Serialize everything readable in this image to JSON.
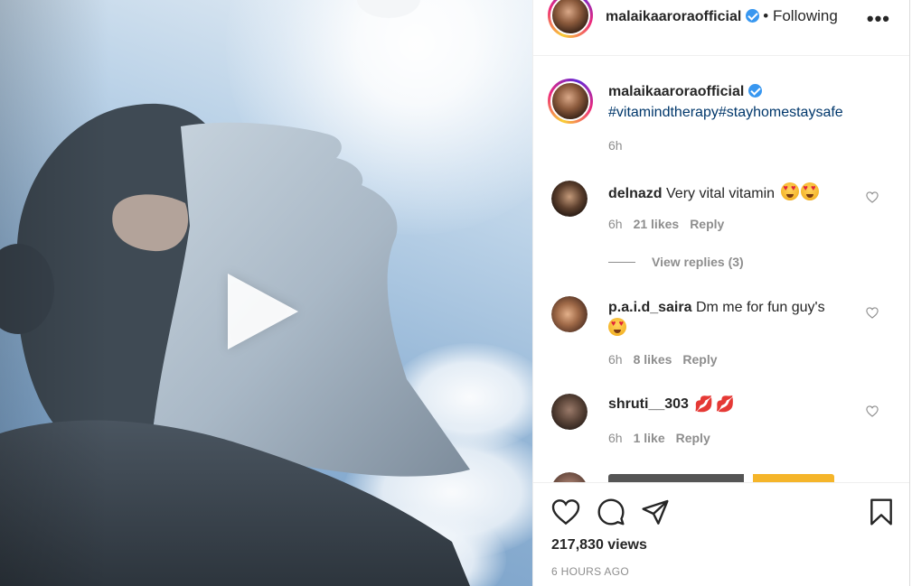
{
  "post": {
    "author": "malaikaaroraofficial",
    "following_label": "• Following",
    "more_label": "•••",
    "caption_hashtags": "#vitamindtherapy#stayhomestaysafe",
    "caption_time": "6h",
    "views": "217,830 views",
    "posted": "6 HOURS AGO"
  },
  "comments": [
    {
      "user": "delnazd",
      "text": "Very vital vitamin",
      "emoji": [
        "heart-eyes",
        "heart-eyes"
      ],
      "time": "6h",
      "likes": "21 likes",
      "reply": "Reply",
      "view_replies": "View replies (3)"
    },
    {
      "user": "p.a.i.d_saira",
      "text": "Dm me for fun guy's",
      "emoji": [
        "heart-eyes"
      ],
      "time": "6h",
      "likes": "8 likes",
      "reply": "Reply"
    },
    {
      "user": "shruti__303",
      "text": "",
      "emoji": [
        "kiss-lips",
        "kiss-lips"
      ],
      "time": "6h",
      "likes": "1 like",
      "reply": "Reply"
    }
  ],
  "colors": {
    "link_blue": "#00376b",
    "verified_blue": "#3897f0",
    "muted_gray": "#8e8e8e",
    "text": "#262626"
  },
  "icons": [
    "play-icon",
    "verified-badge-icon",
    "more-options-icon",
    "heart-icon",
    "comment-icon",
    "share-icon",
    "save-bookmark-icon"
  ]
}
